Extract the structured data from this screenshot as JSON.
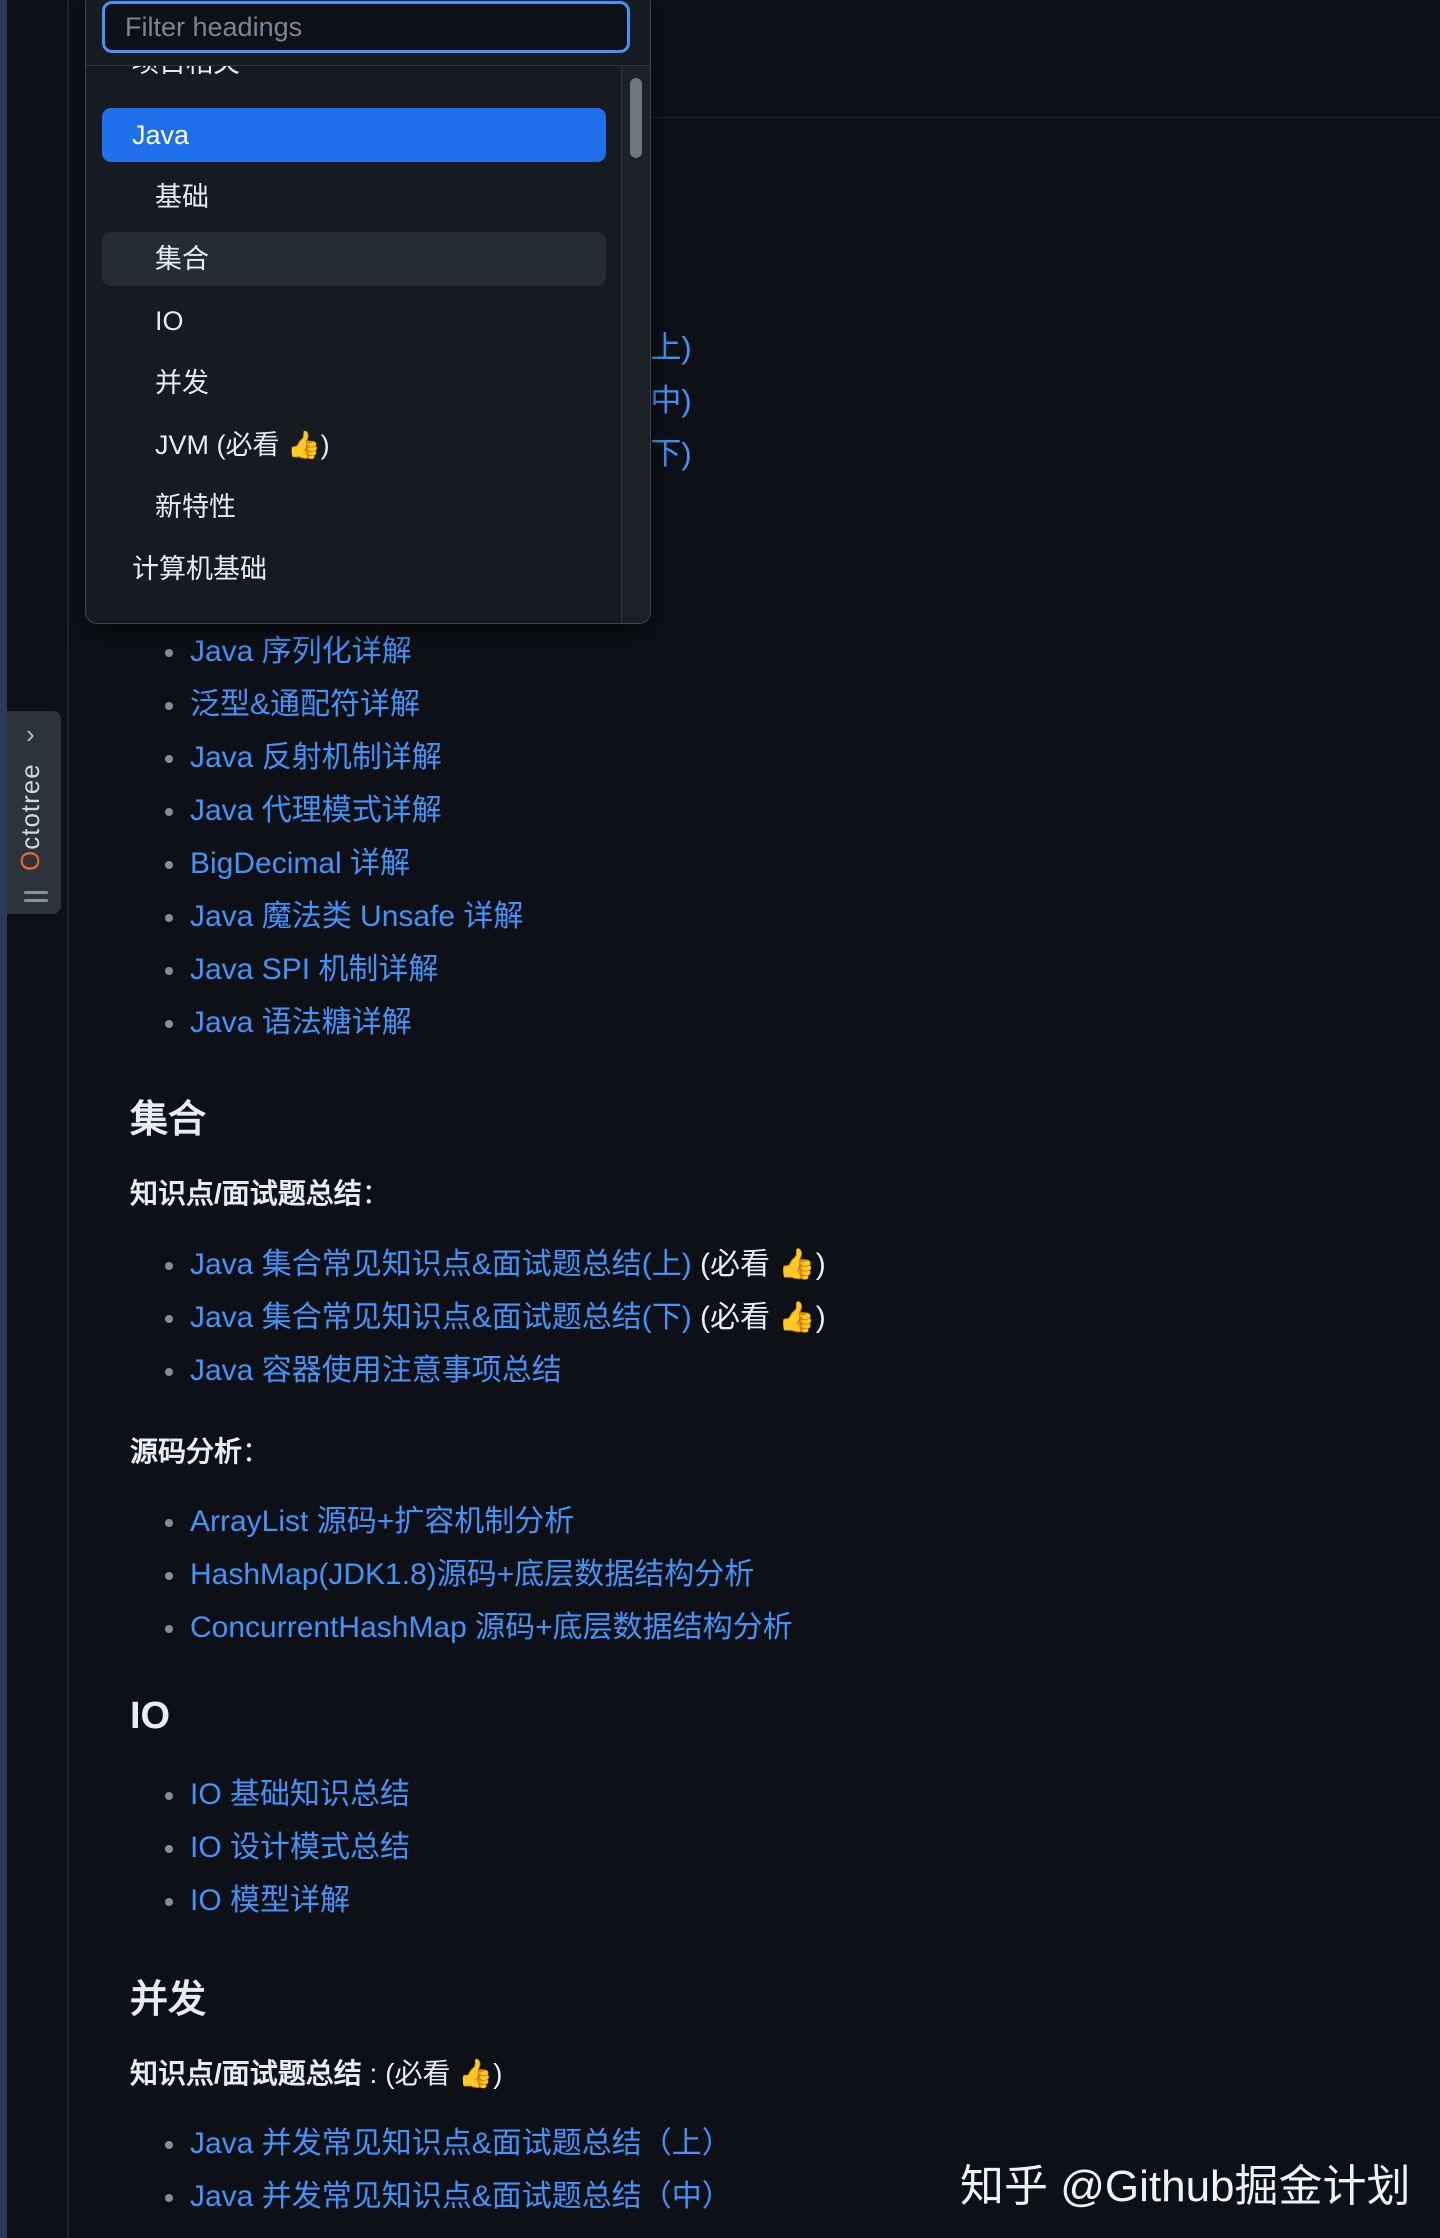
{
  "octotree": {
    "label_first": "O",
    "label_rest": "ctotree"
  },
  "dropdown": {
    "filter_placeholder": "Filter headings",
    "items": [
      {
        "label": "项目相关",
        "level": 1
      },
      {
        "label": "Java",
        "level": 1,
        "state": "active"
      },
      {
        "label": "基础",
        "level": 2
      },
      {
        "label": "集合",
        "level": 2,
        "state": "hover"
      },
      {
        "label": "IO",
        "level": 2
      },
      {
        "label": "并发",
        "level": 2
      },
      {
        "label": "JVM (必看 👍)",
        "level": 2
      },
      {
        "label": "新特性",
        "level": 2
      },
      {
        "label": "计算机基础",
        "level": 1
      }
    ]
  },
  "peek": [
    "(上)",
    "(中)",
    "(下)"
  ],
  "basics_links": [
    "Java 序列化详解",
    "泛型&通配符详解",
    "Java 反射机制详解",
    "Java 代理模式详解",
    "BigDecimal 详解",
    "Java 魔法类 Unsafe 详解",
    "Java SPI 机制详解",
    "Java 语法糖详解"
  ],
  "collections": {
    "heading": "集合",
    "knowledge_label": "知识点/面试题总结",
    "knowledge_colon": "：",
    "knowledge_links": [
      {
        "text": "Java 集合常见知识点&面试题总结(上)",
        "note": " (必看 👍)"
      },
      {
        "text": "Java 集合常见知识点&面试题总结(下)",
        "note": " (必看 👍)"
      },
      {
        "text": "Java 容器使用注意事项总结"
      }
    ],
    "source_label": "源码分析",
    "source_colon": "：",
    "source_links": [
      "ArrayList 源码+扩容机制分析",
      "HashMap(JDK1.8)源码+底层数据结构分析",
      "ConcurrentHashMap 源码+底层数据结构分析"
    ]
  },
  "io": {
    "heading": "IO",
    "links": [
      "IO 基础知识总结",
      "IO 设计模式总结",
      "IO 模型详解"
    ]
  },
  "concurrency": {
    "heading": "并发",
    "knowledge_label": "知识点/面试题总结",
    "knowledge_suffix": " : (必看 👍)",
    "links": [
      "Java 并发常见知识点&面试题总结（上）",
      "Java 并发常见知识点&面试题总结（中）"
    ]
  },
  "watermark": "知乎 @Github掘金计划"
}
